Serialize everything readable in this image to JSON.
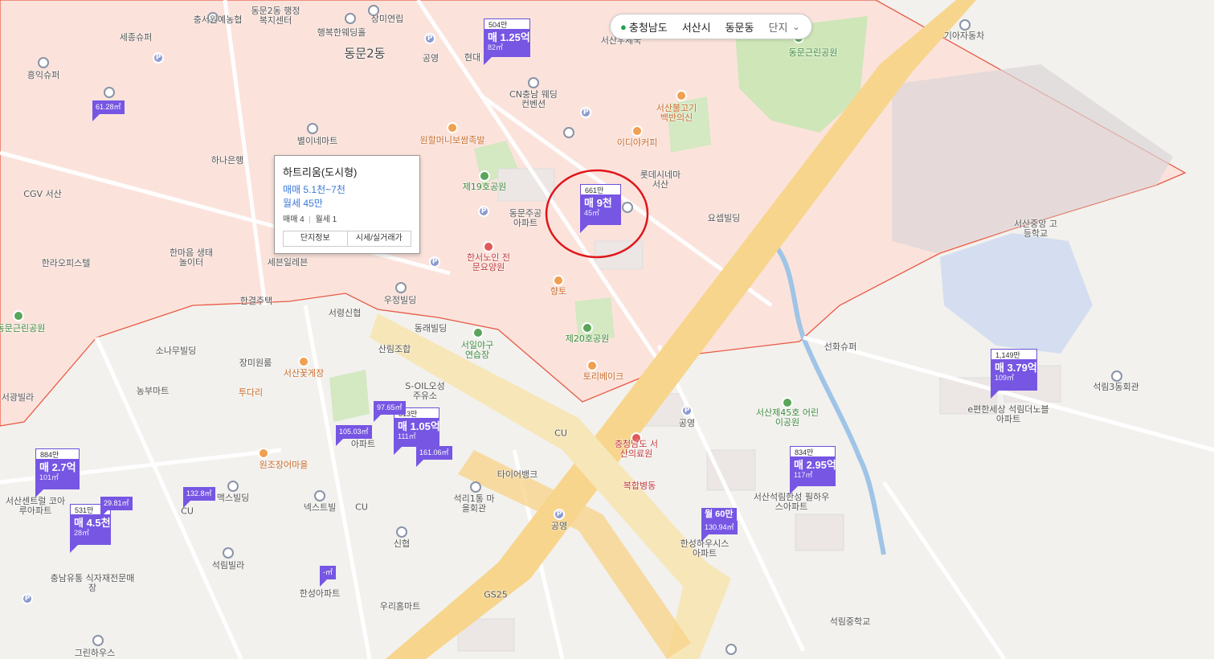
{
  "region_selector": {
    "province": "충청남도",
    "city": "서산시",
    "district": "동문동",
    "mode": "단지"
  },
  "popup": {
    "title": "하트리움(도시형)",
    "sale_price": "매매 5.1천~7천",
    "rent_price": "월세 45만",
    "counts_sale": "매매 4",
    "counts_rent": "월세 1",
    "btn_info": "단지정보",
    "btn_price": "시세/실거래가"
  },
  "markers": [
    {
      "top": "504만",
      "price": "매 1.25억",
      "area": "82㎡"
    },
    {
      "top": "661만",
      "price": "매 9천",
      "area": "45㎡"
    },
    {
      "top": "1,149만",
      "price": "매 3.79억",
      "area": "109㎡"
    },
    {
      "top": "313만",
      "price": "매 1.05억",
      "area": "111㎡"
    },
    {
      "top": "884만",
      "price": "매 2.7억",
      "area": "101㎡"
    },
    {
      "top": "531만",
      "price": "매 4.5천",
      "area": "28㎡"
    },
    {
      "top": "834만",
      "price": "매 2.95억",
      "area": "117㎡"
    }
  ],
  "small_markers": [
    "61.28㎡",
    "97.65㎡",
    "105.03㎡",
    "161.06㎡",
    "132.8㎡",
    "29.81㎡",
    "130.94㎡",
    "-㎡"
  ],
  "rent_marker": "월 60만",
  "labels": {
    "l1": "충서원예농협",
    "l2": "동문2동 행정복지센터",
    "l3": "장미연립",
    "l4": "세종슈퍼",
    "l5": "행복한웨딩홀",
    "l6": "동문2동",
    "l7": "공영",
    "l8": "현대",
    "l9": "서산우체국",
    "l10": "흥익슈퍼",
    "l11": "CN충남 웨딩컨벤션",
    "l12": "원할머니보쌈족발",
    "l13": "별이네마트",
    "l14": "하나은행",
    "l15": "CGV 서산",
    "l16": "제19호공원",
    "l17": "동문주공 아파트",
    "l18": "롯데시네마 서산",
    "l19": "요셉빌딩",
    "l20": "이디야커피",
    "l21": "서산불고기 백반의신",
    "l22": "동문근린공원",
    "l23": "기아자동차",
    "l24": "서산중앙 고등학교",
    "l25": "한라오피스텔",
    "l26": "한마음 생태놀이터",
    "l27": "세븐일레븐",
    "l28": "한서노인 전문요양원",
    "l29": "한결주택",
    "l30": "우정빌딩",
    "l31": "서령신협",
    "l32": "향토",
    "l33": "동래빌딩",
    "l34": "서일야구 연습장",
    "l35": "제20호공원",
    "l36": "동문근린공원",
    "l37": "소나무빌딩",
    "l38": "장미원룸",
    "l39": "서산꽃게장",
    "l40": "산림조합",
    "l41": "S-OIL오성 주유소",
    "l42": "농부마트",
    "l43": "투다리",
    "l44": "서광빌라",
    "l45": "토리베이크",
    "l46": "선화슈퍼",
    "l47": "석림3동회관",
    "l48": "e편한세상 석림더노블아파트",
    "l49": "서산제45호 어린이공원",
    "l50": "공영",
    "l51": "충청남도 서산의료원",
    "l52": "복합병동",
    "l53": "서산석림한성 필하우스아파트",
    "l54": "한성하우시스 아파트",
    "l55": "CU",
    "l56": "타이어뱅크",
    "l57": "원조장어마을",
    "l58": "석리1통 마을회관",
    "l59": "넥스트빌",
    "l60": "CU",
    "l61": "맥스빌딩",
    "l62": "CU",
    "l63": "서산센트럴 코아루아파트",
    "l64": "석림빌라",
    "l65": "충남유통 식자재전문매장",
    "l66": "한성아파트",
    "l67": "신협",
    "l68": "우리홈마트",
    "l69": "GS25",
    "l70": "공영",
    "l71": "그린하우스",
    "l72": "석림중학교",
    "l73": "아파트"
  }
}
